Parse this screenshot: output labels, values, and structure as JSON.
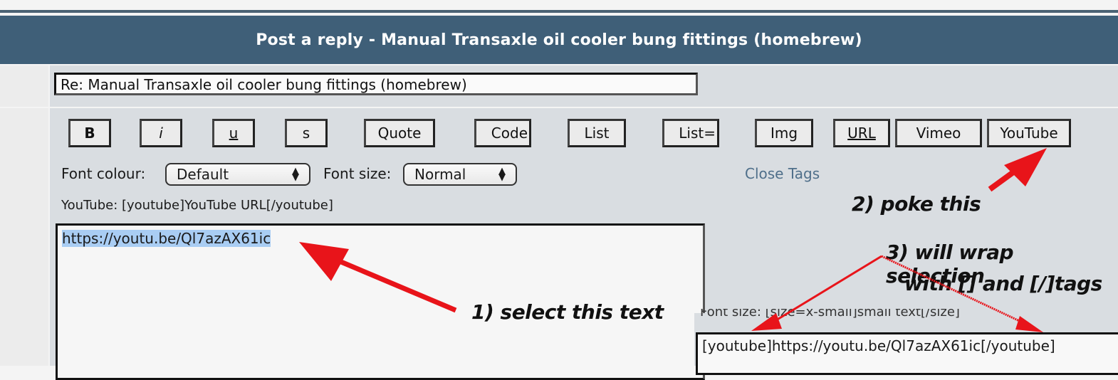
{
  "header": {
    "title": "Post a reply - Manual Transaxle oil cooler bung fittings (homebrew)"
  },
  "subject": {
    "value": "Re: Manual Transaxle oil cooler bung fittings (homebrew)"
  },
  "toolbar": {
    "buttons": [
      {
        "label": "B",
        "style": "bold"
      },
      {
        "label": "i",
        "style": "italic"
      },
      {
        "label": "u",
        "style": "underline"
      },
      {
        "label": "s",
        "style": "normal"
      },
      {
        "label": "Quote",
        "style": "normal"
      },
      {
        "label": "Code",
        "style": "normal"
      },
      {
        "label": "List",
        "style": "normal"
      },
      {
        "label": "List=",
        "style": "normal"
      },
      {
        "label": "Img",
        "style": "normal"
      },
      {
        "label": "URL",
        "style": "underline"
      },
      {
        "label": "Vimeo",
        "style": "normal"
      },
      {
        "label": "YouTube",
        "style": "normal"
      }
    ],
    "font_colour_label": "Font colour:",
    "font_colour_value": "Default",
    "font_size_label": "Font size:",
    "font_size_value": "Normal",
    "close_tags": "Close Tags",
    "helpline": "YouTube: [youtube]YouTube URL[/youtube]"
  },
  "message": {
    "selected_text": "https://youtu.be/Ql7azAX61ic"
  },
  "inset": {
    "helpline": "Font size: [size=x-small]small text[/size]",
    "result_text": "[youtube]https://youtu.be/Ql7azAX61ic[/youtube]"
  },
  "annotations": {
    "step1": "1) select this text",
    "step2": "2) poke this",
    "step3_line1": "3) will wrap selection",
    "step3_line2": "with [] and [/]tags",
    "arrow_color": "#e8141a"
  }
}
